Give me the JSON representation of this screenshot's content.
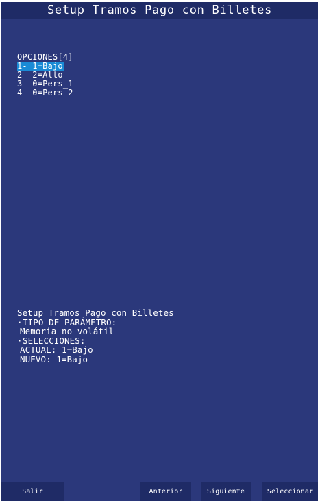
{
  "header": {
    "title": "Setup Tramos Pago con Billetes"
  },
  "options": {
    "header": "OPCIONES[4]",
    "items": [
      {
        "label": "1- 1=Bajo",
        "selected": true
      },
      {
        "label": "2- 2=Alto",
        "selected": false
      },
      {
        "label": "3- 0=Pers_1",
        "selected": false
      },
      {
        "label": "4- 0=Pers_2",
        "selected": false
      }
    ]
  },
  "info": {
    "title": "Setup Tramos Pago con Billetes",
    "bullet": "·",
    "param_type_label": "TIPO DE PARÁMETRO:",
    "param_type_value": "Memoria no volátil",
    "selections_label": "SELECCIONES:",
    "actual": "ACTUAL: 1=Bajo",
    "nuevo": "NUEVO: 1=Bajo"
  },
  "footer": {
    "salir": "Salir",
    "anterior": "Anterior",
    "siguiente": "Siguiente",
    "seleccionar": "Seleccionar"
  },
  "colors": {
    "background": "#2b387b",
    "title_bar": "#1f2b66",
    "selection": "#1a8bd6",
    "text": "#ffffff"
  }
}
